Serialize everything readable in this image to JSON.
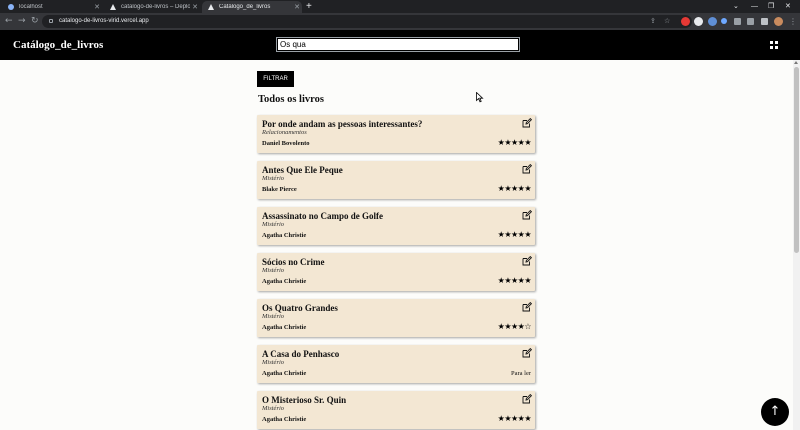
{
  "browser": {
    "tabs": [
      {
        "label": "localhost"
      },
      {
        "label": "catalogo-de-livros – Deployment"
      },
      {
        "label": "Catálogo_de_livros"
      }
    ],
    "url": "catalogo-de-livros-virid.vercel.app"
  },
  "header": {
    "brand": "Catálogo_de_livros",
    "search_value": "Os qua"
  },
  "filter_button": "FILTRAR",
  "section_title": "Todos os livros",
  "books": [
    {
      "title": "Por onde andam as pessoas interessantes?",
      "genre": "Relacionamentos",
      "author": "Daniel Bovolento",
      "rating": "★★★★★",
      "status": ""
    },
    {
      "title": "Antes Que Ele Peque",
      "genre": "Mistério",
      "author": "Blake Pierce",
      "rating": "★★★★★",
      "status": ""
    },
    {
      "title": "Assassinato no Campo de Golfe",
      "genre": "Mistério",
      "author": "Agatha Christie",
      "rating": "★★★★★",
      "status": ""
    },
    {
      "title": "Sócios no Crime",
      "genre": "Mistério",
      "author": "Agatha Christie",
      "rating": "★★★★★",
      "status": ""
    },
    {
      "title": "Os Quatro Grandes",
      "genre": "Mistério",
      "author": "Agatha Christie",
      "rating": "★★★★☆",
      "status": ""
    },
    {
      "title": "A Casa do Penhasco",
      "genre": "Mistério",
      "author": "Agatha Christie",
      "rating": "",
      "status": "Para ler"
    },
    {
      "title": "O Misterioso Sr. Quin",
      "genre": "Mistério",
      "author": "Agatha Christie",
      "rating": "★★★★★",
      "status": ""
    }
  ],
  "fab_symbol": "↑"
}
